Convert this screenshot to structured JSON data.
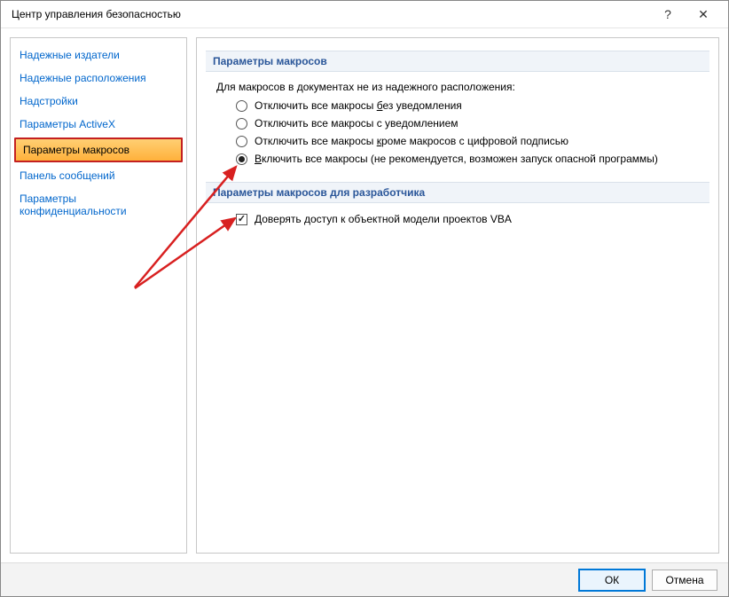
{
  "window": {
    "title": "Центр управления безопасностью"
  },
  "nav": {
    "items": [
      "Надежные издатели",
      "Надежные расположения",
      "Надстройки",
      "Параметры ActiveX",
      "Параметры макросов",
      "Панель сообщений",
      "Параметры конфиденциальности"
    ],
    "selected_index": 4
  },
  "macros": {
    "section_title": "Параметры макросов",
    "description": "Для макросов в документах не из надежного расположения:",
    "options": [
      "Отключить все макросы без уведомления",
      "Отключить все макросы с уведомлением",
      "Отключить все макросы кроме макросов с цифровой подписью",
      "Включить все макросы (не рекомендуется, возможен запуск опасной программы)"
    ],
    "selected_index": 3
  },
  "developer": {
    "section_title": "Параметры макросов для разработчика",
    "trust_vba_label": "Доверять доступ к объектной модели проектов VBA",
    "trust_vba_checked": true
  },
  "buttons": {
    "ok": "ОК",
    "cancel": "Отмена"
  }
}
